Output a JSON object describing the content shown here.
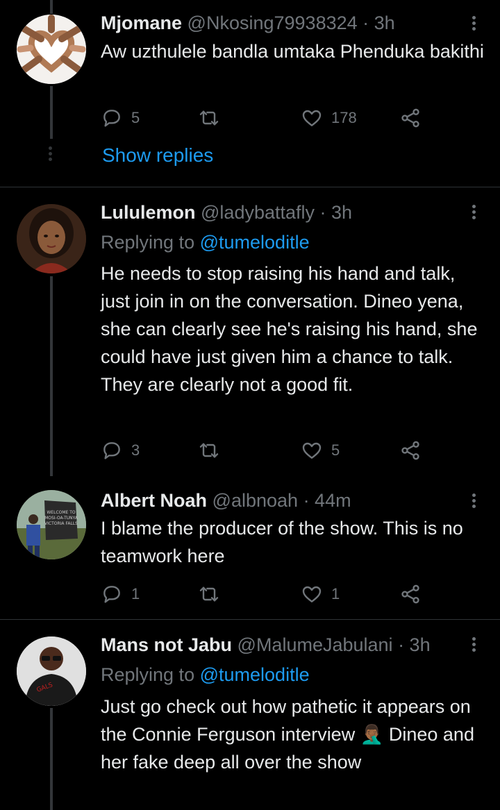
{
  "tweets": [
    {
      "name": "Mjomane",
      "handle": "@Nkosing79938324",
      "time": "· 3h",
      "text": "Aw uzthulele bandla umtaka Phenduka bakithi",
      "replies": "5",
      "retweets": "",
      "likes": "178",
      "show_replies": "Show replies",
      "avatar_icon": "hands-heart-avatar"
    },
    {
      "name": "Lululemon",
      "handle": "@ladybattafly",
      "time": "· 3h",
      "replying_prefix": "Replying to",
      "replying_to": "@tumeloditle",
      "text": "He needs to stop raising his hand and talk, just join in on the conversation. Dineo yena, she can clearly see he's raising his hand, she could have just given him a chance to talk. They are clearly not a good fit.",
      "replies": "3",
      "retweets": "",
      "likes": "5",
      "avatar_icon": "illustrated-woman-avatar"
    },
    {
      "name": "Albert Noah",
      "handle": "@albnoah",
      "time": "· 44m",
      "text": "I blame the producer of the show. This is no teamwork here",
      "replies": "1",
      "retweets": "",
      "likes": "1",
      "avatar_icon": "photo-avatar"
    },
    {
      "name": "Mans not Jabu",
      "handle": "@MalumeJabulani",
      "time": "· 3h",
      "replying_prefix": "Replying to",
      "replying_to": "@tumeloditle",
      "text_part1": "Just go check out how pathetic it appears on the Connie Ferguson interview",
      "text_emoji": "🤦🏾‍♂️",
      "text_part2": "Dineo and her fake deep all over the show",
      "avatar_icon": "man-with-glasses-avatar"
    }
  ],
  "colors": {
    "background": "#000000",
    "text": "#e7e9ea",
    "muted": "#71767b",
    "link": "#1d9bf0",
    "divider": "#2f3336"
  }
}
